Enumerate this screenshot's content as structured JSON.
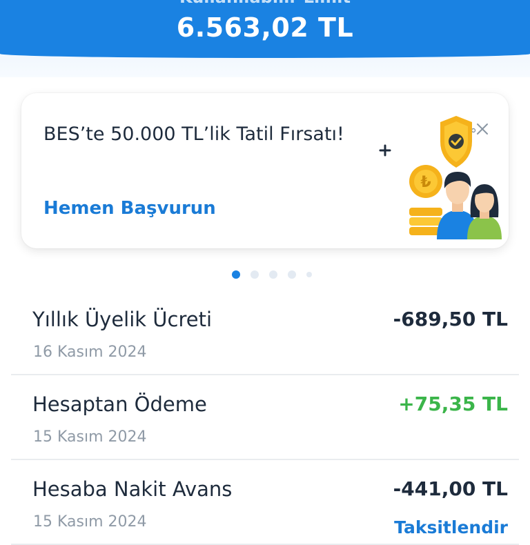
{
  "header": {
    "limit_label": "Kullanılabilir Limit",
    "limit_value": "6.563,02 TL"
  },
  "promo": {
    "title": "BES’te 50.000 TL’lik Tatil Fırsatı!",
    "cta": "Hemen Başvurun",
    "illustration_icons": [
      "shield-check-icon",
      "lira-coin-icon",
      "people-icon"
    ]
  },
  "carousel": {
    "count": 5,
    "active_index": 0
  },
  "transactions": [
    {
      "title": "Yıllık Üyelik Ücreti",
      "date": "16 Kasım 2024",
      "amount": "-689,50 TL",
      "type": "debit"
    },
    {
      "title": "Hesaptan Ödeme",
      "date": "15 Kasım 2024",
      "amount": "+75,35 TL",
      "type": "credit"
    },
    {
      "title": "Hesaba Nakit Avans",
      "date": "15 Kasım 2024",
      "amount": "-441,00 TL",
      "type": "debit",
      "action": "Taksitlendir"
    }
  ],
  "colors": {
    "brand_blue": "#1a82e2",
    "link_blue": "#1a7bd6",
    "credit_green": "#3bb54a",
    "text_dark": "#1e2b3c",
    "text_muted": "#8f9aa6"
  }
}
